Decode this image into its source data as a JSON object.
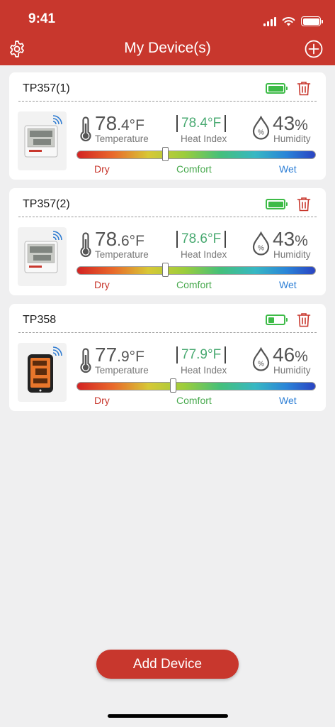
{
  "status_bar": {
    "time": "9:41"
  },
  "header": {
    "title": "My Device(s)",
    "settings_icon": "gear-icon",
    "add_icon": "plus-circle-icon"
  },
  "scale_labels": {
    "dry": "Dry",
    "comfort": "Comfort",
    "wet": "Wet"
  },
  "labels": {
    "temperature": "Temperature",
    "heat_index": "Heat Index",
    "humidity": "Humidity"
  },
  "devices": [
    {
      "name": "TP357(1)",
      "temp_int": "78",
      "temp_dec": ".4",
      "temp_unit": "°F",
      "heat_index": "78.4°F",
      "humidity": "43",
      "hum_unit": "%",
      "battery_level": 1.0,
      "comfort_position": 0.37,
      "display_type": "lcd"
    },
    {
      "name": "TP357(2)",
      "temp_int": "78",
      "temp_dec": ".6",
      "temp_unit": "°F",
      "heat_index": "78.6°F",
      "humidity": "43",
      "hum_unit": "%",
      "battery_level": 1.0,
      "comfort_position": 0.37,
      "display_type": "lcd"
    },
    {
      "name": "TP358",
      "temp_int": "77",
      "temp_dec": ".9",
      "temp_unit": "°F",
      "heat_index": "77.9°F",
      "humidity": "46",
      "hum_unit": "%",
      "battery_level": 0.4,
      "comfort_position": 0.405,
      "display_type": "backlit"
    }
  ],
  "add_button": {
    "label": "Add Device"
  },
  "colors": {
    "brand": "#c8372d",
    "battery": "#3dbb47",
    "heat_index": "#4aaa72",
    "dry": "#c8372d",
    "comfort": "#4aaa50",
    "wet": "#2d7fd6"
  }
}
